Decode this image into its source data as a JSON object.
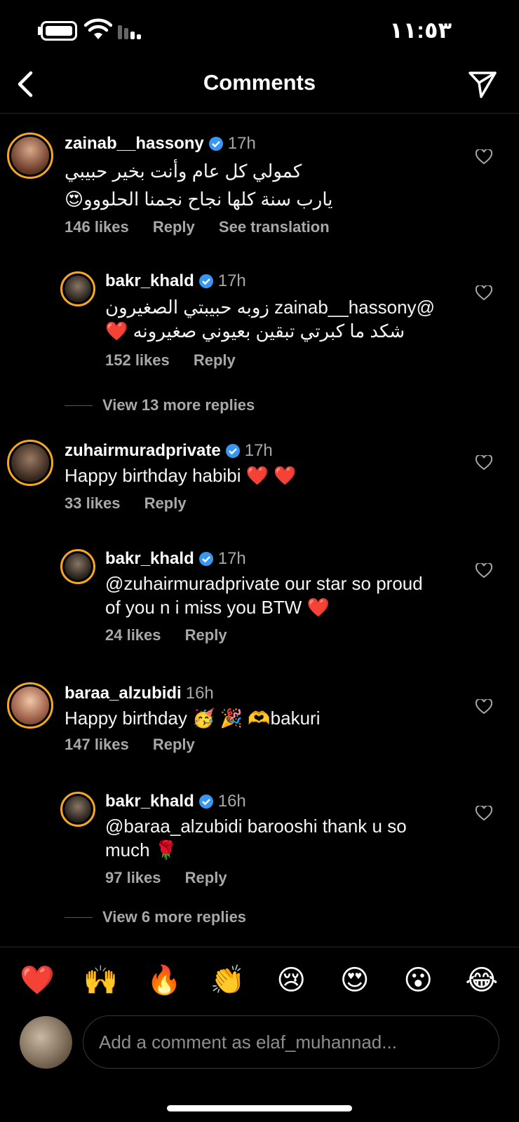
{
  "status_bar": {
    "time": "١١:٥٣"
  },
  "header": {
    "title": "Comments"
  },
  "comments": [
    {
      "username": "zainab__hassony",
      "verified": true,
      "time": "17h",
      "text_lines": [
        "كمولي كل عام وأنت بخير حبيبي",
        "يارب سنة كلها نجاح نجمنا الحلووو😍"
      ],
      "likes": "146 likes",
      "reply": "Reply",
      "translation": "See translation"
    },
    {
      "username": "bakr_khald",
      "verified": true,
      "time": "17h",
      "text_lines": [
        "@zainab__hassony زوبه حبيبتي الصغيرون",
        "شكد ما كبرتي تبقين بعيوني صغيرونه ❤️"
      ],
      "likes": "152 likes",
      "reply": "Reply"
    },
    {
      "username": "zuhairmuradprivate",
      "verified": true,
      "time": "17h",
      "text_lines": [
        "Happy birthday habibi ❤️ ❤️"
      ],
      "likes": "33 likes",
      "reply": "Reply"
    },
    {
      "username": "bakr_khald",
      "verified": true,
      "time": "17h",
      "text_lines": [
        "@zuhairmuradprivate our star so proud",
        "of you n i miss you BTW ❤️"
      ],
      "likes": "24 likes",
      "reply": "Reply"
    },
    {
      "username": "baraa_alzubidi",
      "verified": false,
      "time": "16h",
      "text_lines": [
        "Happy birthday 🥳 🎉 🫶bakuri"
      ],
      "likes": "147 likes",
      "reply": "Reply"
    },
    {
      "username": "bakr_khald",
      "verified": true,
      "time": "16h",
      "text_lines": [
        "@baraa_alzubidi barooshi thank u so",
        "much 🌹"
      ],
      "likes": "97 likes",
      "reply": "Reply"
    }
  ],
  "more_replies": [
    "View 13 more replies",
    "View 6 more replies"
  ],
  "emoji_bar": [
    "❤️",
    "🙌",
    "🔥",
    "👏",
    "😢",
    "😍",
    "😮",
    "😂"
  ],
  "input": {
    "placeholder": "Add a comment as elaf_muhannad..."
  },
  "colors": {
    "background": "#000000",
    "secondary_text": "#a8a8a8",
    "verified": "#3897f0",
    "story_ring": "#e1306c"
  }
}
